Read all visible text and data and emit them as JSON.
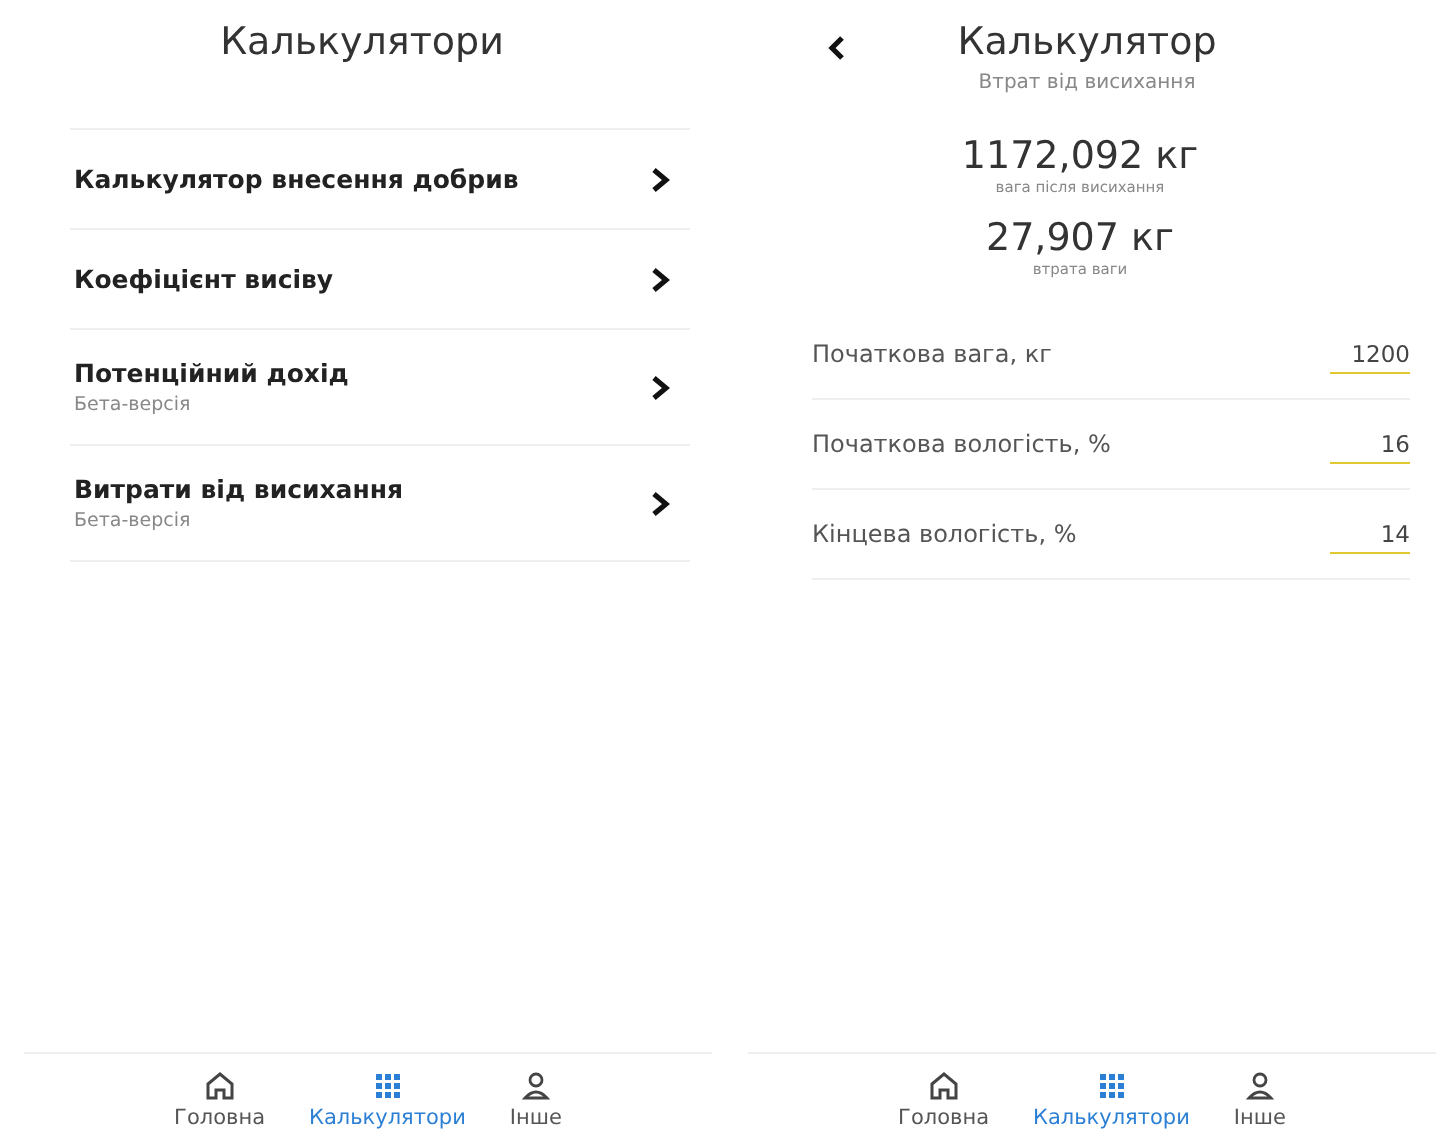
{
  "screens": [
    {
      "kind": "list",
      "title": "Калькулятори",
      "items": [
        {
          "title": "Калькулятор внесення добрив"
        },
        {
          "title": "Коефіцієнт висіву"
        },
        {
          "title": "Потенційний дохід",
          "subtitle": "Бета-версія"
        },
        {
          "title": "Витрати від висихання",
          "subtitle": "Бета-версія"
        }
      ],
      "nav": [
        {
          "label": "Головна",
          "kind": "home",
          "selected": false
        },
        {
          "label": "Калькулятори",
          "kind": "grid",
          "selected": true
        },
        {
          "label": "Інше",
          "kind": "person",
          "selected": false
        }
      ]
    },
    {
      "kind": "calculator",
      "title": "Калькулятор",
      "subtitle": "Втрат від висихання",
      "results": [
        {
          "value": "1172,092 кг",
          "label": "вага після висихання"
        },
        {
          "value": "27,907 кг",
          "label": "втрата ваги"
        }
      ],
      "fields": [
        {
          "label": "Початкова вага, кг",
          "value": "1200"
        },
        {
          "label": "Початкова вологість, %",
          "value": "16"
        },
        {
          "label": "Кінцева вологість, %",
          "value": "14"
        }
      ],
      "nav": [
        {
          "label": "Головна",
          "kind": "home",
          "selected": false
        },
        {
          "label": "Калькулятори",
          "kind": "grid",
          "selected": true
        },
        {
          "label": "Інше",
          "kind": "person",
          "selected": false
        }
      ]
    }
  ]
}
